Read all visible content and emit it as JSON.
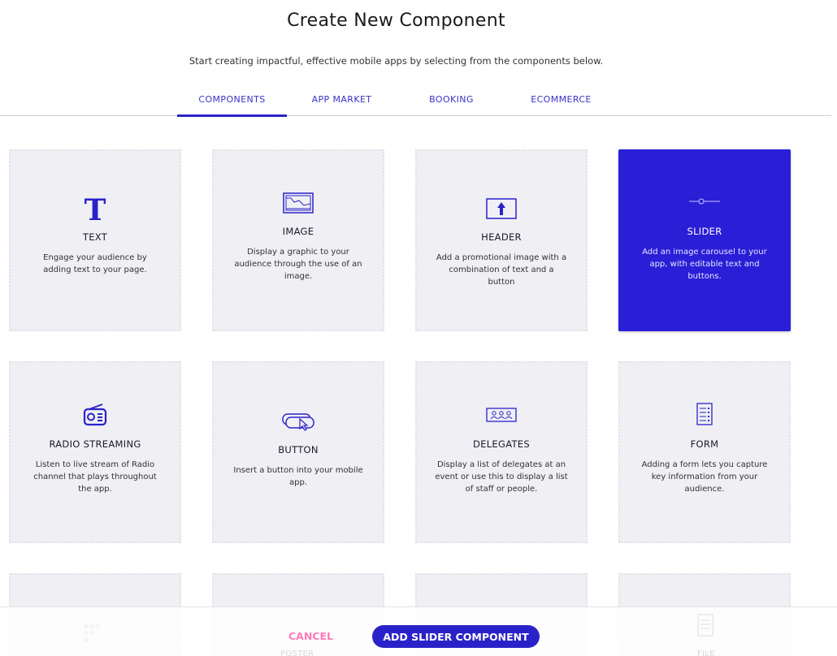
{
  "page": {
    "title": "Create New Component",
    "subtitle": "Start creating impactful, effective mobile apps by selecting from the components below."
  },
  "tabs": [
    {
      "label": "COMPONENTS",
      "active": true
    },
    {
      "label": "APP MARKET",
      "active": false
    },
    {
      "label": "BOOKING",
      "active": false
    },
    {
      "label": "ECOMMERCE",
      "active": false
    }
  ],
  "components": [
    {
      "name": "TEXT",
      "desc": "Engage your audience by adding text to your page.",
      "icon": "text-icon",
      "selected": false
    },
    {
      "name": "IMAGE",
      "desc": "Display a graphic to your audience through the use of an image.",
      "icon": "image-icon",
      "selected": false
    },
    {
      "name": "HEADER",
      "desc": "Add a promotional image with a combination of text and a button",
      "icon": "header-icon",
      "selected": false
    },
    {
      "name": "SLIDER",
      "desc": "Add an image carousel to your app, with editable text and buttons.",
      "icon": "slider-icon",
      "selected": true
    },
    {
      "name": "RADIO STREAMING",
      "desc": "Listen to live stream of Radio channel that plays throughout the app.",
      "icon": "radio-icon",
      "selected": false
    },
    {
      "name": "BUTTON",
      "desc": "Insert a button into your mobile app.",
      "icon": "button-icon",
      "selected": false
    },
    {
      "name": "DELEGATES",
      "desc": "Display a list of delegates at an event or use this to display a list of staff or people.",
      "icon": "delegates-icon",
      "selected": false
    },
    {
      "name": "FORM",
      "desc": "Adding a form lets you capture key information from your audience.",
      "icon": "form-icon",
      "selected": false
    }
  ],
  "partial_components": [
    {
      "name": "",
      "icon": "stars-icon"
    },
    {
      "name": "POSTER",
      "icon": "poster-icon"
    },
    {
      "name": "",
      "icon": "group-icon"
    },
    {
      "name": "FILE",
      "icon": "file-icon"
    }
  ],
  "footer": {
    "text_glyph": "T",
    "cancel_label": "CANCEL",
    "add_label": "ADD SLIDER COMPONENT"
  },
  "colors": {
    "accent": "#2a22c9",
    "selected_card": "#2a1fd6",
    "card_bg": "#efeff4",
    "cancel": "#ff7bb5"
  }
}
